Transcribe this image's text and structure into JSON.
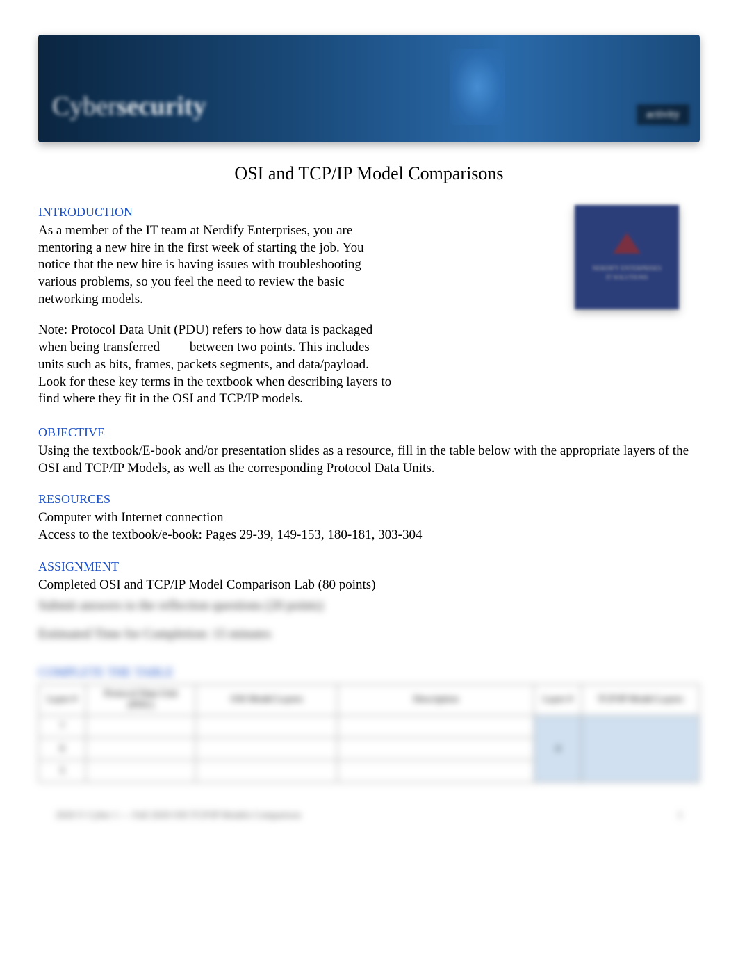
{
  "banner": {
    "text_light": "Cyber",
    "text_bold": "security",
    "badge": "activity"
  },
  "title": "OSI and TCP/IP Model Comparisons",
  "logo": {
    "line1": "NERDIFY ENTERPRISES",
    "line2": "IT SOLUTIONS"
  },
  "sections": {
    "introduction": {
      "heading": "INTRODUCTION",
      "paragraph1": "As a member of the IT team at Nerdify Enterprises, you are mentoring a new hire in the first week of starting the job. You notice that the new hire is having issues with troubleshooting various problems, so you feel the need to review the basic networking models.",
      "paragraph2": "Note: Protocol Data Unit (PDU) refers to how data is packaged when being transferred         between two points. This includes units such as bits, frames, packets segments, and data/payload. Look for these key terms in the textbook when describing layers to find where they fit in the OSI and TCP/IP models."
    },
    "objective": {
      "heading": "OBJECTIVE",
      "text": "Using the textbook/E-book and/or presentation slides as a resource, fill in the table below with the appropriate layers of the OSI and TCP/IP Models, as well as the corresponding Protocol Data Units."
    },
    "resources": {
      "heading": "RESOURCES",
      "line1": "Computer with Internet connection",
      "line2": "Access to the textbook/e-book: Pages 29-39, 149-153, 180-181, 303-304"
    },
    "assignment": {
      "heading": "ASSIGNMENT",
      "line1": "Completed OSI and TCP/IP Model Comparison Lab (80 points)",
      "blurred1": "Submit answers to the reflection questions (20 points)",
      "blurred2": "Estimated Time for Completion: 15 minutes"
    }
  },
  "table": {
    "heading": "COMPLETE THE TABLE",
    "headers": {
      "layer": "Layer #",
      "pdu": "Protocol Data Unit (PDU)",
      "osi": "OSI Model Layers",
      "desc": "Description",
      "layer2": "Layer #",
      "tcpip": "TCP/IP Model Layers"
    },
    "rows": [
      {
        "layer": "7",
        "merged_layer2": "4"
      },
      {
        "layer": "6"
      },
      {
        "layer": "5"
      }
    ]
  },
  "footer": {
    "left": "2020 © Cyber 1 — Fall 2020 OSI TCP/IP Models Comparison",
    "right": "1"
  }
}
